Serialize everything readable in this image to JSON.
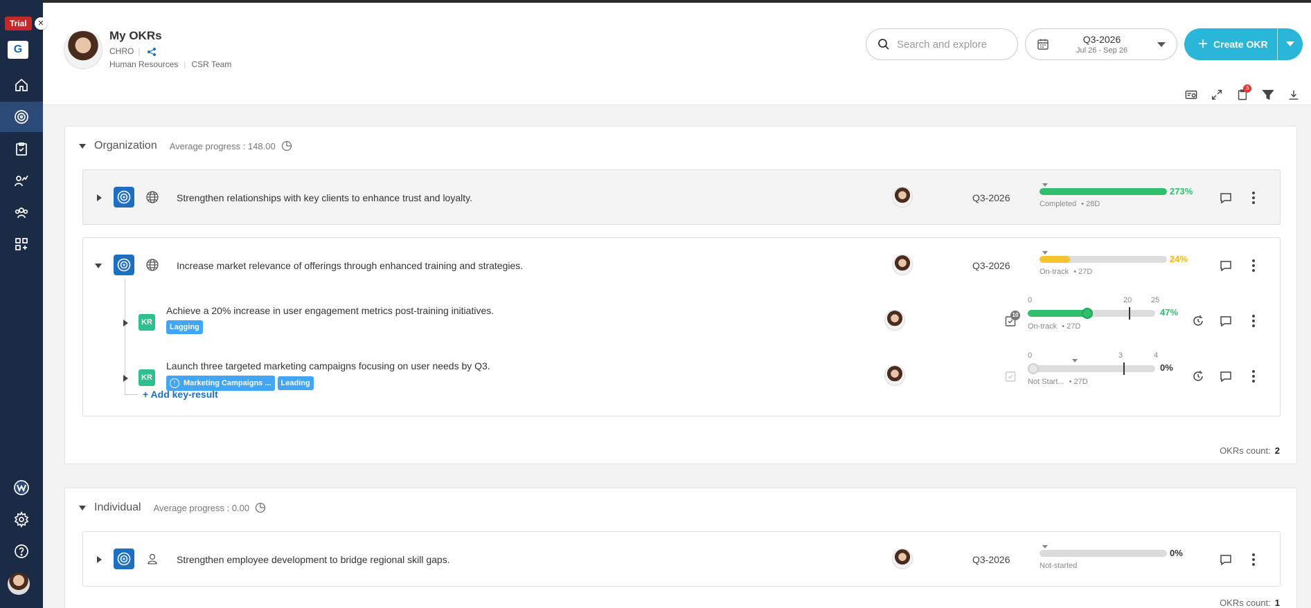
{
  "sidebar": {
    "trial_label": "Trial",
    "trial_close": "✕",
    "logo_letter": "G",
    "nav": [
      "home-icon",
      "target-icon",
      "clipboard-icon",
      "chart-user-icon",
      "team-icon",
      "apps-icon"
    ],
    "bottom": [
      "w-logo-icon",
      "gear-icon",
      "help-icon",
      "avatar"
    ]
  },
  "header": {
    "name": "My OKRs",
    "role": "CHRO",
    "department": "Human Resources",
    "team": "CSR Team",
    "search_placeholder": "Search and explore",
    "period_title": "Q3-2026",
    "period_range": "Jul 26 - Sep 26",
    "create_label": "Create OKR",
    "notification_count": "3"
  },
  "sections": {
    "org": {
      "title": "Organization",
      "avg": "Average progress : 148.00",
      "count_label": "OKRs count:",
      "count": "2",
      "okrs": {
        "o1": {
          "title": "Strengthen relationships with key clients to enhance trust and loyalty.",
          "period": "Q3-2026",
          "progress": 273,
          "pct": "273%",
          "status": "Completed",
          "days": "• 28D",
          "color": "#2fbf6f"
        },
        "o2": {
          "title": "Increase market relevance of offerings through enhanced training and strategies.",
          "period": "Q3-2026",
          "progress": 24,
          "pct": "24%",
          "status": "On-track",
          "days": "• 27D",
          "color": "#f9c12e",
          "krs": {
            "k1": {
              "badge": "KR",
              "title": "Achieve a 20% increase in user engagement metrics post-training initiatives.",
              "tag1": "Lagging",
              "tick_start": "0",
              "tick_target": "20",
              "tick_end": "25",
              "progress": 47,
              "pct": "47%",
              "status": "On-track",
              "days": "• 27D",
              "task_count": "10"
            },
            "k2": {
              "badge": "KR",
              "title": "Launch three targeted marketing campaigns focusing on user needs by Q3.",
              "tag1": "Marketing Campaigns ...",
              "tag2": "Leading",
              "tick_start": "0",
              "tick_target": "3",
              "tick_end": "4",
              "progress": 0,
              "pct": "0%",
              "status": "Not Start...",
              "days": "• 27D"
            }
          },
          "add_kr": "+ Add key-result"
        }
      }
    },
    "ind": {
      "title": "Individual",
      "avg": "Average progress : 0.00",
      "count_label": "OKRs count:",
      "count": "1",
      "okrs": {
        "o1": {
          "title": "Strengthen employee development to bridge regional skill gaps.",
          "period": "Q3-2026",
          "progress": 0,
          "pct": "0%",
          "status": "Not-started",
          "days": ""
        }
      }
    }
  }
}
